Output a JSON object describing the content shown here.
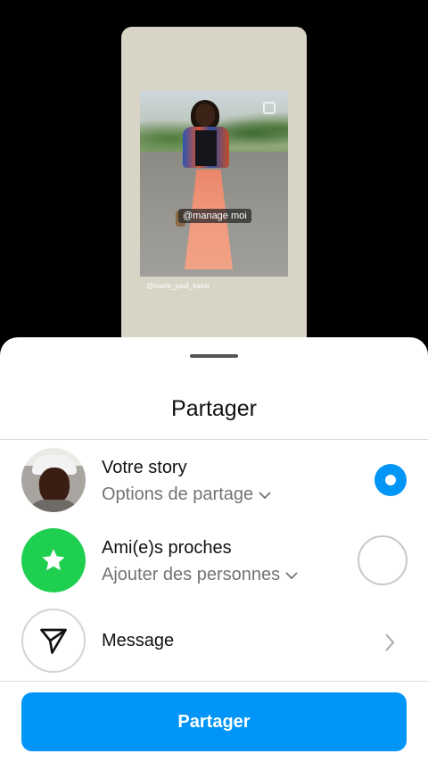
{
  "story_preview": {
    "mention_tag": "@manage moi",
    "credit_text": "@marie_paul_kassi"
  },
  "sheet": {
    "title": "Partager",
    "options": [
      {
        "title": "Votre story",
        "subtitle": "Options de partage",
        "selected": true,
        "icon": "profile-photo"
      },
      {
        "title": "Ami(e)s proches",
        "subtitle": "Ajouter des personnes",
        "selected": false,
        "icon": "star-icon"
      },
      {
        "title": "Message",
        "icon": "send-icon"
      }
    ],
    "share_button_label": "Partager"
  },
  "colors": {
    "accent": "#0095f6",
    "close_friends": "#1fcf4f"
  }
}
